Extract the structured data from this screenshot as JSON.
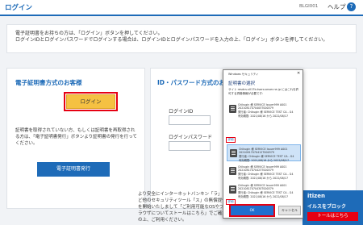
{
  "header": {
    "title": "ログイン",
    "screen_code": "BLGI001",
    "help_label": "ヘルプ",
    "help_icon": "?"
  },
  "notice": {
    "line1": "電子証明書をお持ちの方は、「ログイン」ボタンを押してください。",
    "line2": "ログインIDとログインパスワードでログインする場合は、ログインIDとログインパスワードを入力の上、「ログイン」ボタンを押してください。"
  },
  "cert_section": {
    "heading": "電子証明書方式のお客様",
    "login_label": "ログイン",
    "description": "証明書を取得されていない方、もしくは証明書を再取得される方は、「電子証明書発行」ボタンより証明書の発行を行ってください。",
    "issue_button": "電子証明書発行"
  },
  "id_section": {
    "heading": "ID・パスワード方式のお",
    "login_id_label": "ログインID",
    "password_label": "ログインパスワード"
  },
  "bottom_text": "より安全にインターネットバンキン「ラ」など他のセキュリティツール「ス」の無償提供を開始いたしまして「ご利用可能なOSやブラウザについてストールはこちら」でご確認の上、ご利用ください。",
  "banner": {
    "line1": "itizen",
    "line2": "イルスをブロック",
    "link": "トールはこちら"
  },
  "dialog": {
    "title": "Windows セキュリティ",
    "close": "✕",
    "heading": "証明書の選択",
    "description": "サイト resdcs.s017b.tsaro.anser.ne.jp にはこれを許可する資格情報が必要です:",
    "more_top": "詳細",
    "more": "詳細",
    "certs": [
      {
        "name": "Chikugin 様 SERVICE Issuer999 A001",
        "serial": "20210817070405T000379",
        "issuer": "発行者: Chikugin 様 SERVICE TEST CA - G4",
        "valid": "有効期間: 2021/08/16 から 2022/08/17",
        "selected": false
      },
      {
        "name": "Chikugin 様 SERVICE Issuer999 A001",
        "serial": "20210817070412T000379",
        "issuer": "発行者: Chikugin 様 SERVICE TEST CA - G4",
        "valid": "有効期間: 2021/08/16 から 2022/08/17",
        "selected": true
      },
      {
        "name": "Chikugin 様 SERVICE Issuer999 A001",
        "serial": "20210817070423T000379",
        "issuer": "発行者: Chikugin 様 SERVICE TEST CA - G4",
        "valid": "有効期間: 2021/08/16 から 2022/08/17",
        "selected": false
      },
      {
        "name": "Chikugin 様 SERVICE Issuer999 A001",
        "serial": "20210817070430T000379",
        "issuer": "発行者: Chikugin 様 SERVICE TEST CA - G4",
        "valid": "有効期間: 2021/08/16 から 2022/08/17",
        "selected": false
      }
    ],
    "ok_label": "OK",
    "cancel_label": "キャンセル"
  }
}
